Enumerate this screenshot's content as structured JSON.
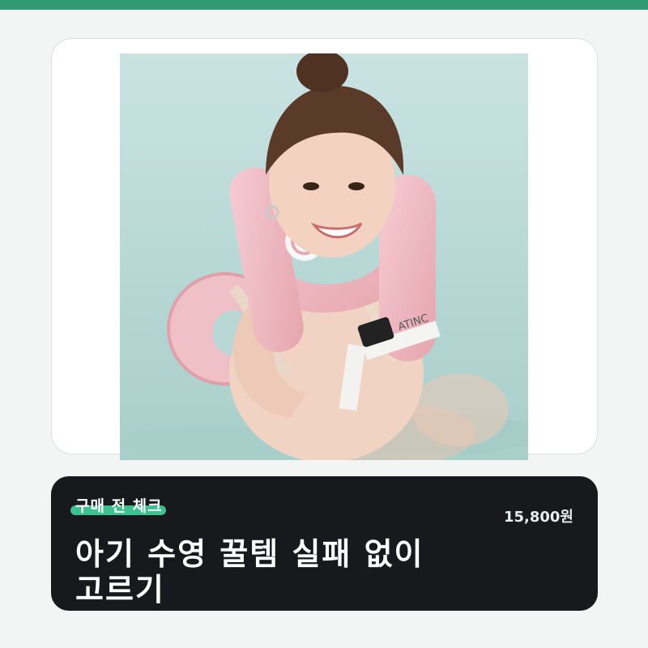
{
  "colors": {
    "accent": "#2f9a72",
    "highlight": "#3cc18f",
    "panel": "#17191c"
  },
  "card": {
    "image_alt": "Child wearing a pink inflatable swim ring in a pool",
    "float_brand_text": "ATINC"
  },
  "info": {
    "tag": "구매 전 체크",
    "price": "15,800원",
    "title_line1": "아기 수영 꿀템 실패 없이",
    "title_line2": "고르기"
  }
}
